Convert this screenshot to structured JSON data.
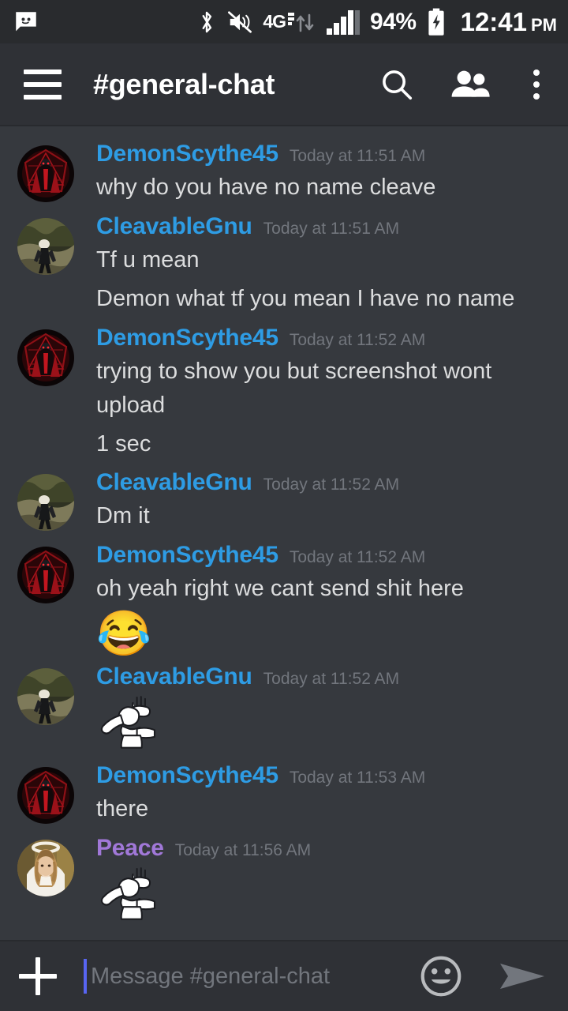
{
  "status_bar": {
    "notification_icon": "message-bubble-icon",
    "icons": [
      "bluetooth-icon",
      "volume-muted-icon",
      "4g-lte-icon",
      "signal-bars-icon"
    ],
    "network_label": "4G",
    "battery_percent": "94%",
    "battery_icon": "battery-charging-icon",
    "time": "12:41",
    "meridiem": "PM"
  },
  "header": {
    "menu_icon": "hamburger-menu-icon",
    "channel_name": "#general-chat",
    "search_icon": "search-icon",
    "members_icon": "members-icon",
    "overflow_icon": "overflow-menu-icon"
  },
  "colors": {
    "background": "#36393e",
    "header_bg": "#2f3136",
    "status_bar_bg": "#292b2e",
    "username_blue": "#2e9ce4",
    "username_purple": "#a178d8",
    "message_text": "#dcddde",
    "timestamp": "#72767d",
    "caret_blue": "#5865f2"
  },
  "messages": [
    {
      "author": "DemonScythe45",
      "author_color": "blue",
      "timestamp": "Today at 11:51 AM",
      "avatar": "demonscythe45-avatar",
      "lines": [
        {
          "type": "text",
          "text": "why do you have no name cleave"
        }
      ]
    },
    {
      "author": "CleavableGnu",
      "author_color": "blue",
      "timestamp": "Today at 11:51 AM",
      "avatar": "cleavablegnu-avatar",
      "lines": [
        {
          "type": "text",
          "text": "Tf u mean"
        },
        {
          "type": "text",
          "text": "Demon what tf you mean I have no name"
        }
      ]
    },
    {
      "author": "DemonScythe45",
      "author_color": "blue",
      "timestamp": "Today at 11:52 AM",
      "avatar": "demonscythe45-avatar",
      "lines": [
        {
          "type": "text",
          "text": "trying to show you but screenshot wont upload"
        },
        {
          "type": "text",
          "text": "1 sec"
        }
      ]
    },
    {
      "author": "CleavableGnu",
      "author_color": "blue",
      "timestamp": "Today at 11:52 AM",
      "avatar": "cleavablegnu-avatar",
      "lines": [
        {
          "type": "text",
          "text": "Dm it"
        }
      ]
    },
    {
      "author": "DemonScythe45",
      "author_color": "blue",
      "timestamp": "Today at 11:52 AM",
      "avatar": "demonscythe45-avatar",
      "lines": [
        {
          "type": "text",
          "text": "oh yeah right we cant send shit here"
        },
        {
          "type": "emoji",
          "text": "😂",
          "name": "face-with-tears-of-joy-emoji"
        }
      ]
    },
    {
      "author": "CleavableGnu",
      "author_color": "blue",
      "timestamp": "Today at 11:52 AM",
      "avatar": "cleavablegnu-avatar",
      "lines": [
        {
          "type": "sticker",
          "name": "dab-figure-emoji"
        }
      ]
    },
    {
      "author": "DemonScythe45",
      "author_color": "blue",
      "timestamp": "Today at 11:53 AM",
      "avatar": "demonscythe45-avatar",
      "lines": [
        {
          "type": "text",
          "text": "there"
        }
      ]
    },
    {
      "author": "Peace",
      "author_color": "purple",
      "timestamp": "Today at 11:56 AM",
      "avatar": "peace-avatar",
      "lines": [
        {
          "type": "sticker",
          "name": "dab-figure-emoji"
        }
      ]
    }
  ],
  "input_bar": {
    "add_icon": "plus-icon",
    "placeholder": "Message #general-chat",
    "emoji_icon": "emoji-smiley-icon",
    "send_icon": "send-arrow-icon"
  }
}
